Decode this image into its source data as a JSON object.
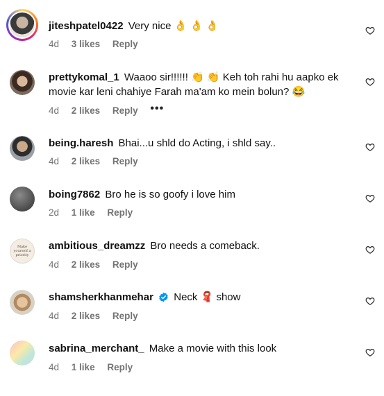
{
  "comments": [
    {
      "username": "jiteshpatel0422",
      "text": "Very nice",
      "emojis": [
        "👌",
        "👌",
        "👌"
      ],
      "age": "4d",
      "likes": "3 likes",
      "reply": "Reply"
    },
    {
      "username": "prettykomal_1",
      "text_a": "Waaoo sir!!!!!!",
      "emojis_a": [
        "👏",
        "👏"
      ],
      "text_b": "Keh toh rahi hu aapko ek movie kar leni chahiye Farah ma'am ko mein bolun?",
      "emoji_end": "😂",
      "age": "4d",
      "likes": "2 likes",
      "reply": "Reply",
      "more": "•••"
    },
    {
      "username": "being.haresh",
      "text": "Bhai...u shld do Acting, i shld say..",
      "age": "4d",
      "likes": "2 likes",
      "reply": "Reply"
    },
    {
      "username": "boing7862",
      "text": "Bro he is so goofy i love him",
      "age": "2d",
      "likes": "1 like",
      "reply": "Reply"
    },
    {
      "username": "ambitious_dreamzz",
      "text": "Bro needs a comeback.",
      "avatar_text": "Make yourself a priority",
      "age": "4d",
      "likes": "2 likes",
      "reply": "Reply"
    },
    {
      "username": "shamsherkhanmehar",
      "verified": true,
      "text_a": "Neck",
      "emoji": "🧣",
      "text_b": "show",
      "age": "4d",
      "likes": "2 likes",
      "reply": "Reply"
    },
    {
      "username": "sabrina_merchant_",
      "text": "Make a movie with this look",
      "age": "4d",
      "likes": "1 like",
      "reply": "Reply"
    }
  ],
  "icons": {
    "like": "heart-outline-icon",
    "verified": "verified-badge-icon",
    "more": "more-dots-icon"
  },
  "colors": {
    "meta": "#737373",
    "verified": "#0095f6"
  }
}
